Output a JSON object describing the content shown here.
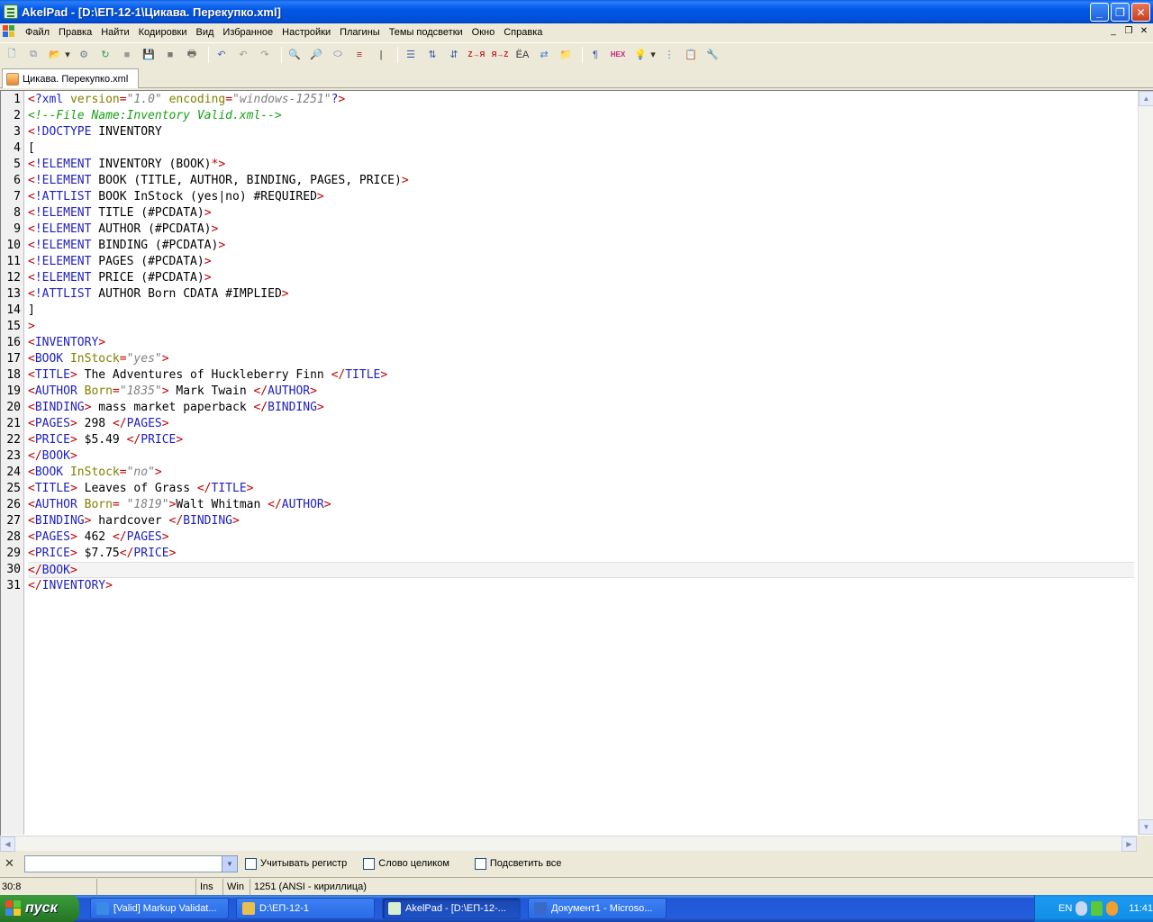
{
  "window": {
    "title": "AkelPad - [D:\\ЕП-12-1\\Цикава. Перекупко.xml]",
    "controls": {
      "minimize": "_",
      "maximize": "❐",
      "close": "✕"
    }
  },
  "menu": {
    "items": [
      "Файл",
      "Правка",
      "Найти",
      "Кодировки",
      "Вид",
      "Избранное",
      "Настройки",
      "Плагины",
      "Темы подсветки",
      "Окно",
      "Справка"
    ],
    "mdi_controls": {
      "minimize": "_",
      "restore": "❐",
      "close": "✕"
    }
  },
  "toolbar": {
    "icons": [
      {
        "name": "new-file-icon",
        "glyph": "🗋",
        "color": "#5a7fb8"
      },
      {
        "name": "new-window-icon",
        "glyph": "⧉",
        "color": "#7a8aa8"
      },
      {
        "name": "open-file-icon",
        "glyph": "📂",
        "color": "#d8a030"
      },
      {
        "name": "open-dropdown-icon",
        "glyph": "▾",
        "color": "#333333"
      },
      {
        "name": "recent-files-icon",
        "glyph": "⚙",
        "color": "#6a7a9a"
      },
      {
        "name": "reopen-icon",
        "glyph": "↻",
        "color": "#2a9a4a"
      },
      {
        "name": "save-disabled-icon",
        "glyph": "■",
        "color": "#9a9a9a"
      },
      {
        "name": "save-icon",
        "glyph": "💾",
        "color": "#3a5aa8"
      },
      {
        "name": "save-all-icon",
        "glyph": "■",
        "color": "#7a7a7a"
      },
      {
        "name": "print-icon",
        "glyph": "🖶",
        "color": "#6a6a6a"
      },
      {
        "name": "undo-all-icon",
        "glyph": "↶",
        "color": "#4a6ab8"
      },
      {
        "name": "undo-icon",
        "glyph": "↶",
        "color": "#9a9a9a"
      },
      {
        "name": "redo-icon",
        "glyph": "↷",
        "color": "#9a9a9a"
      },
      {
        "name": "find-icon",
        "glyph": "🔍",
        "color": "#3a5aa8"
      },
      {
        "name": "find-next-icon",
        "glyph": "🔎",
        "color": "#3a5aa8"
      },
      {
        "name": "replace-icon",
        "glyph": "⬭",
        "color": "#4a6ab8"
      },
      {
        "name": "goto-icon",
        "glyph": "≡",
        "color": "#a03030"
      },
      {
        "name": "cursor-icon",
        "glyph": "|",
        "color": "#333333"
      },
      {
        "name": "list-icon",
        "glyph": "☰",
        "color": "#3a5aa8"
      },
      {
        "name": "sort-asc-icon",
        "glyph": "⇅",
        "color": "#3a5aa8"
      },
      {
        "name": "sort-desc-icon",
        "glyph": "⇵",
        "color": "#3a5aa8"
      },
      {
        "name": "upper-case-icon",
        "glyph": "Z→Я",
        "color": "#c02020"
      },
      {
        "name": "lower-case-icon",
        "glyph": "Я→Z",
        "color": "#c02020"
      },
      {
        "name": "transliterate-icon",
        "glyph": "ЁА",
        "color": "#333333"
      },
      {
        "name": "convert-icon",
        "glyph": "⇄",
        "color": "#3a7ad8"
      },
      {
        "name": "explorer-icon",
        "glyph": "📁",
        "color": "#d8a030"
      },
      {
        "name": "pilcrow-icon",
        "glyph": "¶",
        "color": "#3a5aa8"
      },
      {
        "name": "hex-icon",
        "glyph": "HEX",
        "color": "#c02080"
      },
      {
        "name": "highlight-icon",
        "glyph": "💡",
        "color": "#e0b020"
      },
      {
        "name": "highlight-dropdown-icon",
        "glyph": "▾",
        "color": "#333333"
      },
      {
        "name": "code-fold-icon",
        "glyph": "⋮",
        "color": "#3a7ad8"
      },
      {
        "name": "clipboard-icon",
        "glyph": "📋",
        "color": "#b08a40"
      },
      {
        "name": "settings-tools-icon",
        "glyph": "🔧",
        "color": "#3a7ad8"
      }
    ]
  },
  "tab": {
    "label": "Цикава. Перекупко.xml"
  },
  "editor": {
    "current_line": 30,
    "line_numbers": [
      "1",
      "2",
      "3",
      "4",
      "5",
      "6",
      "7",
      "8",
      "9",
      "10",
      "11",
      "12",
      "13",
      "14",
      "15",
      "16",
      "17",
      "18",
      "19",
      "20",
      "21",
      "22",
      "23",
      "24",
      "25",
      "26",
      "27",
      "28",
      "29",
      "30",
      "31"
    ],
    "lines": [
      [
        [
          "bk",
          "<"
        ],
        [
          "kw",
          "?xml "
        ],
        [
          "at",
          "version"
        ],
        [
          "bk",
          "="
        ],
        [
          "st",
          "\"1.0\""
        ],
        [
          "tx",
          " "
        ],
        [
          "at",
          "encoding"
        ],
        [
          "bk",
          "="
        ],
        [
          "st",
          "\"windows-1251\""
        ],
        [
          "kw",
          "?"
        ],
        [
          "bk",
          ">"
        ]
      ],
      [
        [
          "cm",
          "<!--File Name:Inventory Valid.xml-->"
        ]
      ],
      [
        [
          "bk",
          "<"
        ],
        [
          "kw",
          "!DOCTYPE"
        ],
        [
          "tx",
          " INVENTORY"
        ]
      ],
      [
        [
          "tx",
          "["
        ]
      ],
      [
        [
          "bk",
          "<"
        ],
        [
          "kw",
          "!ELEMENT"
        ],
        [
          "tx",
          " INVENTORY (BOOK)"
        ],
        [
          "bk",
          "*>"
        ]
      ],
      [
        [
          "bk",
          "<"
        ],
        [
          "kw",
          "!ELEMENT"
        ],
        [
          "tx",
          " BOOK (TITLE, AUTHOR, BINDING, PAGES, PRICE)"
        ],
        [
          "bk",
          ">"
        ]
      ],
      [
        [
          "bk",
          "<"
        ],
        [
          "kw",
          "!ATTLIST"
        ],
        [
          "tx",
          " BOOK InStock (yes|no) #REQUIRED"
        ],
        [
          "bk",
          ">"
        ]
      ],
      [
        [
          "bk",
          "<"
        ],
        [
          "kw",
          "!ELEMENT"
        ],
        [
          "tx",
          " TITLE (#PCDATA)"
        ],
        [
          "bk",
          ">"
        ]
      ],
      [
        [
          "bk",
          "<"
        ],
        [
          "kw",
          "!ELEMENT"
        ],
        [
          "tx",
          " AUTHOR (#PCDATA)"
        ],
        [
          "bk",
          ">"
        ]
      ],
      [
        [
          "bk",
          "<"
        ],
        [
          "kw",
          "!ELEMENT"
        ],
        [
          "tx",
          " BINDING (#PCDATA)"
        ],
        [
          "bk",
          ">"
        ]
      ],
      [
        [
          "bk",
          "<"
        ],
        [
          "kw",
          "!ELEMENT"
        ],
        [
          "tx",
          " PAGES (#PCDATA)"
        ],
        [
          "bk",
          ">"
        ]
      ],
      [
        [
          "bk",
          "<"
        ],
        [
          "kw",
          "!ELEMENT"
        ],
        [
          "tx",
          " PRICE (#PCDATA)"
        ],
        [
          "bk",
          ">"
        ]
      ],
      [
        [
          "bk",
          "<"
        ],
        [
          "kw",
          "!ATTLIST"
        ],
        [
          "tx",
          " AUTHOR Born CDATA #IMPLIED"
        ],
        [
          "bk",
          ">"
        ]
      ],
      [
        [
          "tx",
          "]"
        ]
      ],
      [
        [
          "bk",
          ">"
        ]
      ],
      [
        [
          "bk",
          "<"
        ],
        [
          "kw",
          "INVENTORY"
        ],
        [
          "bk",
          ">"
        ]
      ],
      [
        [
          "bk",
          "<"
        ],
        [
          "kw",
          "BOOK "
        ],
        [
          "at",
          "InStock"
        ],
        [
          "bk",
          "="
        ],
        [
          "st",
          "\"yes\""
        ],
        [
          "bk",
          ">"
        ]
      ],
      [
        [
          "bk",
          "<"
        ],
        [
          "kw",
          "TITLE"
        ],
        [
          "bk",
          ">"
        ],
        [
          "tx",
          " The Adventures of Huckleberry Finn "
        ],
        [
          "bk",
          "</"
        ],
        [
          "kw",
          "TITLE"
        ],
        [
          "bk",
          ">"
        ]
      ],
      [
        [
          "bk",
          "<"
        ],
        [
          "kw",
          "AUTHOR "
        ],
        [
          "at",
          "Born"
        ],
        [
          "bk",
          "="
        ],
        [
          "st",
          "\"1835\""
        ],
        [
          "bk",
          ">"
        ],
        [
          "tx",
          " Mark Twain "
        ],
        [
          "bk",
          "</"
        ],
        [
          "kw",
          "AUTHOR"
        ],
        [
          "bk",
          ">"
        ]
      ],
      [
        [
          "bk",
          "<"
        ],
        [
          "kw",
          "BINDING"
        ],
        [
          "bk",
          ">"
        ],
        [
          "tx",
          " mass market paperback "
        ],
        [
          "bk",
          "</"
        ],
        [
          "kw",
          "BINDING"
        ],
        [
          "bk",
          ">"
        ]
      ],
      [
        [
          "bk",
          "<"
        ],
        [
          "kw",
          "PAGES"
        ],
        [
          "bk",
          ">"
        ],
        [
          "tx",
          " 298 "
        ],
        [
          "bk",
          "</"
        ],
        [
          "kw",
          "PAGES"
        ],
        [
          "bk",
          ">"
        ]
      ],
      [
        [
          "bk",
          "<"
        ],
        [
          "kw",
          "PRICE"
        ],
        [
          "bk",
          ">"
        ],
        [
          "tx",
          " $5.49 "
        ],
        [
          "bk",
          "</"
        ],
        [
          "kw",
          "PRICE"
        ],
        [
          "bk",
          ">"
        ]
      ],
      [
        [
          "bk",
          "</"
        ],
        [
          "kw",
          "BOOK"
        ],
        [
          "bk",
          ">"
        ]
      ],
      [
        [
          "bk",
          "<"
        ],
        [
          "kw",
          "BOOK "
        ],
        [
          "at",
          "InStock"
        ],
        [
          "bk",
          "="
        ],
        [
          "st",
          "\"no\""
        ],
        [
          "bk",
          ">"
        ]
      ],
      [
        [
          "bk",
          "<"
        ],
        [
          "kw",
          "TITLE"
        ],
        [
          "bk",
          ">"
        ],
        [
          "tx",
          " Leaves of Grass "
        ],
        [
          "bk",
          "</"
        ],
        [
          "kw",
          "TITLE"
        ],
        [
          "bk",
          ">"
        ]
      ],
      [
        [
          "bk",
          "<"
        ],
        [
          "kw",
          "AUTHOR "
        ],
        [
          "at",
          "Born"
        ],
        [
          "bk",
          "="
        ],
        [
          "tx",
          " "
        ],
        [
          "st",
          "\"1819\""
        ],
        [
          "bk",
          ">"
        ],
        [
          "tx",
          "Walt Whitman "
        ],
        [
          "bk",
          "</"
        ],
        [
          "kw",
          "AUTHOR"
        ],
        [
          "bk",
          ">"
        ]
      ],
      [
        [
          "bk",
          "<"
        ],
        [
          "kw",
          "BINDING"
        ],
        [
          "bk",
          ">"
        ],
        [
          "tx",
          " hardcover "
        ],
        [
          "bk",
          "</"
        ],
        [
          "kw",
          "BINDING"
        ],
        [
          "bk",
          ">"
        ]
      ],
      [
        [
          "bk",
          "<"
        ],
        [
          "kw",
          "PAGES"
        ],
        [
          "bk",
          ">"
        ],
        [
          "tx",
          " 462 "
        ],
        [
          "bk",
          "</"
        ],
        [
          "kw",
          "PAGES"
        ],
        [
          "bk",
          ">"
        ]
      ],
      [
        [
          "bk",
          "<"
        ],
        [
          "kw",
          "PRICE"
        ],
        [
          "bk",
          ">"
        ],
        [
          "tx",
          " $7.75"
        ],
        [
          "bk",
          "</"
        ],
        [
          "kw",
          "PRICE"
        ],
        [
          "bk",
          ">"
        ]
      ],
      [
        [
          "bk",
          "</"
        ],
        [
          "kw",
          "BOOK"
        ],
        [
          "bk",
          ">"
        ]
      ],
      [
        [
          "bk",
          "</"
        ],
        [
          "kw",
          "INVENTORY"
        ],
        [
          "bk",
          ">"
        ]
      ]
    ]
  },
  "findbar": {
    "close_glyph": "✕",
    "search_value": "",
    "dropdown_glyph": "▼",
    "options": [
      "Учитывать регистр",
      "Слово целиком",
      "Подсветить все"
    ]
  },
  "statusbar": {
    "position": "30:8",
    "empty_cell": "",
    "insert_mode": "Ins",
    "newline": "Win",
    "encoding": "1251  (ANSI - кириллица)"
  },
  "taskbar": {
    "start_label": "пуск",
    "tasks": [
      {
        "label": "[Valid] Markup Validat...",
        "icon_color": "#3a8ae8",
        "active": false
      },
      {
        "label": "D:\\ЕП-12-1",
        "icon_color": "#e8c050",
        "active": false
      },
      {
        "label": "AkelPad - [D:\\ЕП-12-...",
        "icon_color": "#d8f0d0",
        "active": true
      },
      {
        "label": "Документ1 - Microso...",
        "icon_color": "#3a6ac8",
        "active": false
      }
    ],
    "tray": {
      "language": "EN",
      "clock": "11:41"
    }
  },
  "colors": {
    "keyword": "#2020c0",
    "bracket": "#c00000",
    "string": "#808080",
    "attribute": "#808000",
    "comment": "#18a018"
  }
}
